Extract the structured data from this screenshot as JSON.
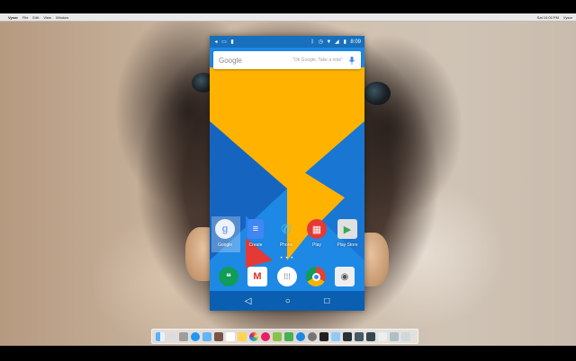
{
  "menubar": {
    "apple": "",
    "app_name": "Vysor",
    "items": [
      "File",
      "Edit",
      "View",
      "Window"
    ],
    "right": [
      "Sat 10:00 PM",
      "Vysor"
    ]
  },
  "status_bar": {
    "time": "8:09",
    "icons": [
      "back-icon",
      "cast-icon",
      "battery-saver-icon",
      "bluetooth-icon",
      "alarm-icon",
      "wifi-icon",
      "signal-icon",
      "battery-icon"
    ]
  },
  "search": {
    "logo": "Google",
    "hint": "\"Ok Google, Take a note\""
  },
  "home_apps": [
    {
      "label": "Google",
      "icon": "google-icon",
      "color": "#e8eef7"
    },
    {
      "label": "Create",
      "icon": "docs-icon",
      "color": "#4285f4"
    },
    {
      "label": "Phone",
      "icon": "phone-icon",
      "color": "#0288d1"
    },
    {
      "label": "Play",
      "icon": "play-icon",
      "color": "#e53935"
    },
    {
      "label": "Play Store",
      "icon": "play-store-icon",
      "color": "#e0e0e0"
    }
  ],
  "dock_apps": [
    {
      "name": "Hangouts",
      "icon": "hangouts-icon",
      "color": "#0f9d58"
    },
    {
      "name": "Gmail",
      "icon": "gmail-icon",
      "color": "#ffffff"
    },
    {
      "name": "Apps",
      "icon": "app-drawer-icon",
      "color": "#ffffff"
    },
    {
      "name": "Chrome",
      "icon": "chrome-icon",
      "color": "#db4437"
    },
    {
      "name": "Photos",
      "icon": "camera-icon",
      "color": "#eeeeee"
    }
  ],
  "page_dots": "• • •",
  "nav": {
    "back": "◁",
    "home": "○",
    "recents": "□"
  },
  "colors": {
    "wallpaper_yellow": "#ffb300",
    "wallpaper_blue": "#1e88e5",
    "wallpaper_dark_blue": "#1565c0",
    "wallpaper_red": "#e53935",
    "nav_bar": "#0a5fb0"
  }
}
